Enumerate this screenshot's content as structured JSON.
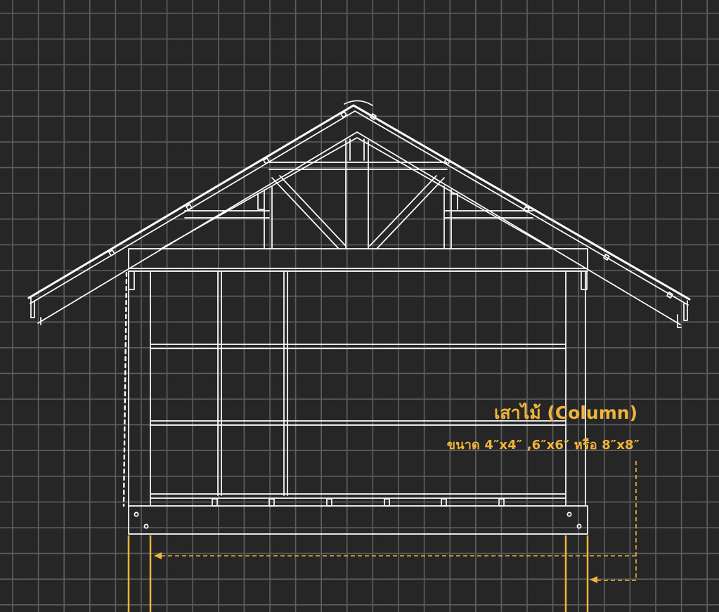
{
  "annotation": {
    "title": "เสาไม้ (Column)",
    "spec": "ขนาด 4″x4″ ,6″x6″ หรือ 8″x8″"
  },
  "colors": {
    "background": "#262626",
    "grid": "#5e5e5e",
    "linework": "#ffffff",
    "accent": "#f0b43a"
  }
}
